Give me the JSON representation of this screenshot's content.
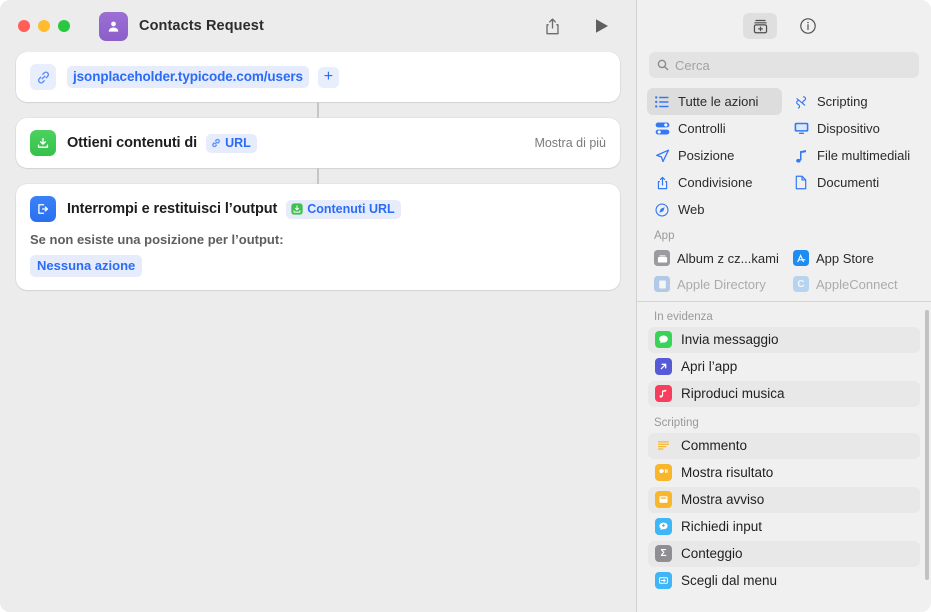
{
  "window": {
    "title": "Contacts Request",
    "traffic_lights": [
      "close",
      "minimize",
      "zoom"
    ]
  },
  "toolbar": {
    "share_icon": "share-icon",
    "run_icon": "play-icon"
  },
  "workflow": {
    "url_action": {
      "icon": "link-icon",
      "url": "jsonplaceholder.typicode.com/users",
      "add_label": "+"
    },
    "get_contents_action": {
      "icon": "download-tray-icon",
      "label": "Ottieni contenuti di",
      "token": "URL",
      "token_icon": "link-icon",
      "show_more": "Mostra di più"
    },
    "stop_action": {
      "icon": "exit-door-icon",
      "label": "Interrompi e restituisci l’output",
      "token": "Contenuti URL",
      "token_icon": "download-tray-icon",
      "sub_label": "Se non esiste una posizione per l’output:",
      "sub_value": "Nessuna azione"
    }
  },
  "sidebar": {
    "toolbar": {
      "library_icon": "action-library-icon",
      "info_icon": "info-circle-icon"
    },
    "search": {
      "placeholder": "Cerca",
      "value": "",
      "icon": "search-icon"
    },
    "categories": [
      {
        "label": "Tutte le azioni",
        "icon": "list-bullets-icon",
        "selected": true,
        "accent": "#3478f6"
      },
      {
        "label": "Scripting",
        "icon": "scripting-icon",
        "selected": false,
        "accent": "#3478f6"
      },
      {
        "label": "Controlli",
        "icon": "controls-icon",
        "selected": false,
        "accent": "#3478f6"
      },
      {
        "label": "Dispositivo",
        "icon": "display-icon",
        "selected": false,
        "accent": "#3478f6"
      },
      {
        "label": "Posizione",
        "icon": "location-arrow-icon",
        "selected": false,
        "accent": "#3478f6"
      },
      {
        "label": "File multimediali",
        "icon": "music-note-icon",
        "selected": false,
        "accent": "#3478f6"
      },
      {
        "label": "Condivisione",
        "icon": "share-icon",
        "selected": false,
        "accent": "#3478f6"
      },
      {
        "label": "Documenti",
        "icon": "document-icon",
        "selected": false,
        "accent": "#3478f6"
      },
      {
        "label": "Web",
        "icon": "safari-compass-icon",
        "selected": false,
        "accent": "#3478f6"
      }
    ],
    "app_section": {
      "title": "App",
      "apps": [
        {
          "label": "Album z cz...kami",
          "icon": "photos-album-icon",
          "color": "#8e8e93"
        },
        {
          "label": "App Store",
          "icon": "app-store-icon",
          "color": "#2b8ef6"
        },
        {
          "label": "Apple Directory",
          "icon": "directory-icon",
          "color": "#3d7fd9"
        },
        {
          "label": "AppleConnect",
          "icon": "appleconnect-icon",
          "color": "#4aa3f0"
        }
      ]
    },
    "featured_section": {
      "title": "In evidenza",
      "items": [
        {
          "label": "Invia messaggio",
          "icon": "messages-icon",
          "color": "#39d35a",
          "alt": true
        },
        {
          "label": "Apri l’app",
          "icon": "open-app-icon",
          "color": "#5659d8",
          "alt": false
        },
        {
          "label": "Riproduci musica",
          "icon": "music-app-icon",
          "color": "#f93d5c",
          "alt": true
        }
      ]
    },
    "scripting_section": {
      "title": "Scripting",
      "items": [
        {
          "label": "Commento",
          "icon": "comment-icon",
          "color": "#f8b62c",
          "alt": true
        },
        {
          "label": "Mostra risultato",
          "icon": "show-result-icon",
          "color": "#f8b62c",
          "alt": false
        },
        {
          "label": "Mostra avviso",
          "icon": "alert-icon",
          "color": "#f8b62c",
          "alt": true
        },
        {
          "label": "Richiedi input",
          "icon": "ask-input-icon",
          "color": "#3fb6f7",
          "alt": false
        },
        {
          "label": "Conteggio",
          "icon": "count-sigma-icon",
          "color": "#8e8e93",
          "alt": true
        },
        {
          "label": "Scegli dal menu",
          "icon": "choose-menu-icon",
          "color": "#3fb6f7",
          "alt": false
        }
      ]
    }
  }
}
